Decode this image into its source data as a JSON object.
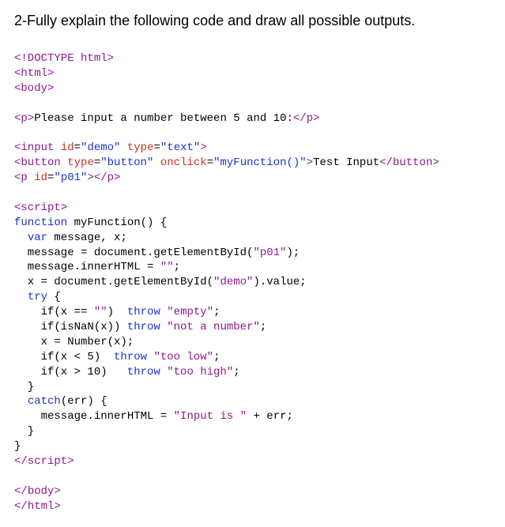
{
  "title": "2-Fully explain the following code and draw all possible outputs.",
  "code": {
    "l1": "<!DOCTYPE html>",
    "l2_open": "<",
    "l2_tag": "html",
    "l2_close": ">",
    "l3_open": "<",
    "l3_tag": "body",
    "l3_close": ">",
    "l5_open": "<",
    "l5_tag": "p",
    "l5_close": ">",
    "l5_text": "Please input a number between 5 and 10:",
    "l5_endopen": "</",
    "l5_endclose": ">",
    "l7_open": "<",
    "l7_tag": "input",
    "l7_sp": " ",
    "l7_attr1": "id",
    "l7_eq": "=",
    "l7_val1": "\"demo\"",
    "l7_attr2": "type",
    "l7_val2": "\"text\"",
    "l7_close": ">",
    "l8_open": "<",
    "l8_tag": "button",
    "l8_attr1": "type",
    "l8_val1": "\"button\"",
    "l8_attr2": "onclick",
    "l8_val2": "\"myFunction()\"",
    "l8_close": ">",
    "l8_text": "Test Input",
    "l8_endopen": "</",
    "l8_endclose": ">",
    "l9_open": "<",
    "l9_tag": "p",
    "l9_attr1": "id",
    "l9_val1": "\"p01\"",
    "l9_close": ">",
    "l9_endopen": "</",
    "l9_endclose": ">",
    "l11_open": "<",
    "l11_tag": "script",
    "l11_close": ">",
    "s1_kw": "function",
    "s1_rest": " myFunction() {",
    "s2_kw": "var",
    "s2_rest": " message, x;",
    "s3": "  message = document.getElementById(",
    "s3_str": "\"p01\"",
    "s3_end": ");",
    "s4": "  message.innerHTML = ",
    "s4_str": "\"\"",
    "s4_end": ";",
    "s5": "  x = document.getElementById(",
    "s5_str": "\"demo\"",
    "s5_end": ").value;",
    "s6_kw": "try",
    "s6_rest": " {",
    "s7a": "    if(x == ",
    "s7a_str": "\"\"",
    "s7a_mid": ")  ",
    "s7a_kw": "throw",
    "s7a_sp": " ",
    "s7a_str2": "\"empty\"",
    "s7a_end": ";",
    "s7b": "    if(isNaN(x)) ",
    "s7b_kw": "throw",
    "s7b_sp": " ",
    "s7b_str": "\"not a number\"",
    "s7b_end": ";",
    "s7c": "    x = Number(x);",
    "s7d": "    if(x < 5)  ",
    "s7d_kw": "throw",
    "s7d_sp": " ",
    "s7d_str": "\"too low\"",
    "s7d_end": ";",
    "s7e": "    if(x > 10)   ",
    "s7e_kw": "throw",
    "s7e_sp": " ",
    "s7e_str": "\"too high\"",
    "s7e_end": ";",
    "s8": "  }",
    "s9_kw": "catch",
    "s9_rest": "(err) {",
    "s10": "    message.innerHTML = ",
    "s10_str": "\"Input is \"",
    "s10_end": " + err;",
    "s11": "  }",
    "s12": "}",
    "l_end_script_open": "</",
    "l_end_script_tag": "script",
    "l_end_script_close": ">",
    "l_end_body_open": "</",
    "l_end_body_tag": "body",
    "l_end_body_close": ">",
    "l_end_html_open": "</",
    "l_end_html_tag": "html",
    "l_end_html_close": ">"
  }
}
